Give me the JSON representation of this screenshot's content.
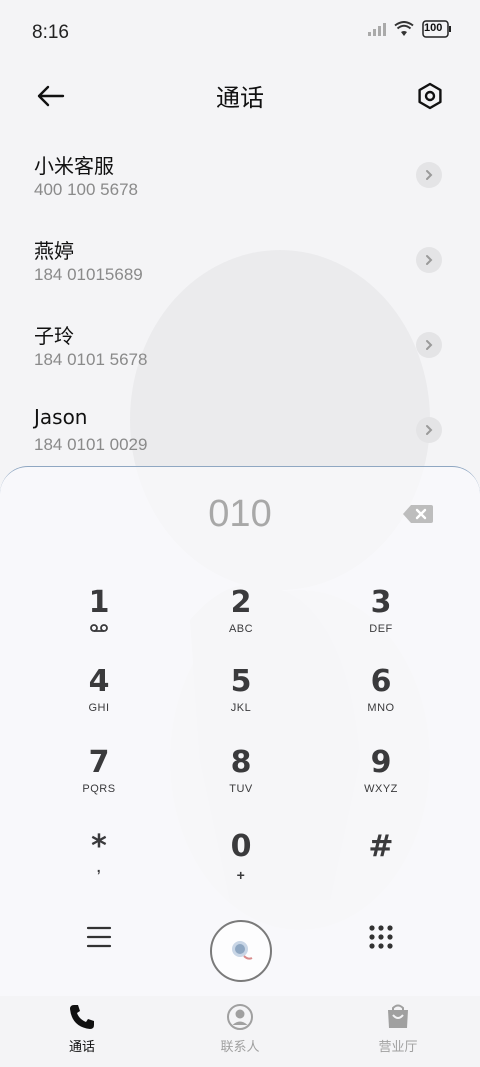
{
  "status_bar": {
    "time": "8:16",
    "battery": "100"
  },
  "header": {
    "title": "通话",
    "back_icon": "arrow-left-icon",
    "settings_icon": "hexagon-settings-icon"
  },
  "contacts": [
    {
      "name": "小米客服",
      "number": "400 100 5678"
    },
    {
      "name": "燕婷",
      "number": "184 01015689"
    },
    {
      "name": "子玲",
      "number": "184 0101 5678"
    },
    {
      "name": "Jason",
      "number": "184 0101 0029"
    }
  ],
  "dialpad": {
    "input": "010",
    "keys": [
      {
        "digit": "1",
        "letters": ""
      },
      {
        "digit": "2",
        "letters": "ABC"
      },
      {
        "digit": "3",
        "letters": "DEF"
      },
      {
        "digit": "4",
        "letters": "GHI"
      },
      {
        "digit": "5",
        "letters": "JKL"
      },
      {
        "digit": "6",
        "letters": "MNO"
      },
      {
        "digit": "7",
        "letters": "PQRS"
      },
      {
        "digit": "8",
        "letters": "TUV"
      },
      {
        "digit": "9",
        "letters": "WXYZ"
      },
      {
        "digit": "*",
        "letters": ","
      },
      {
        "digit": "0",
        "letters": "+"
      },
      {
        "digit": "#",
        "letters": ""
      }
    ]
  },
  "bottom_nav": [
    {
      "label": "通话",
      "icon": "phone-icon",
      "active": true
    },
    {
      "label": "联系人",
      "icon": "person-icon",
      "active": false
    },
    {
      "label": "营业厅",
      "icon": "bag-icon",
      "active": false
    }
  ],
  "colors": {
    "active": "#111111",
    "inactive": "#a0a0a0",
    "dialpad_border": "#8fa7c2"
  }
}
